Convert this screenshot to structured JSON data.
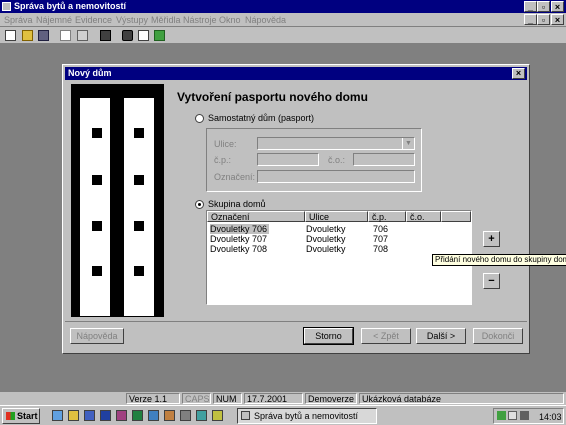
{
  "app": {
    "title": "Správa bytů a nemovitostí",
    "controls": {
      "minimize": "_",
      "restore": "▫",
      "close": "×"
    }
  },
  "menubar": [
    {
      "label": "Správa",
      "enabled": false
    },
    {
      "label": "Nájemné",
      "enabled": false
    },
    {
      "label": "Evidence",
      "enabled": false
    },
    {
      "label": "Výstupy",
      "enabled": false
    },
    {
      "label": "Měřidla",
      "enabled": false
    },
    {
      "label": "Nástroje",
      "enabled": false
    },
    {
      "label": "Okno",
      "enabled": false
    },
    {
      "label": "Nápověda",
      "enabled": false
    }
  ],
  "toolbar": [
    "new-file-icon",
    "open-folder-icon",
    "save-icon",
    "print-preview-icon",
    "print-icon",
    "binoculars-icon",
    "tools-icon",
    "grid-icon",
    "paint-icon"
  ],
  "dialog": {
    "title": "Nový dům",
    "close": "×",
    "heading": "Vytvoření pasportu nového domu",
    "option_single": "Samostatný dům (pasport)",
    "street_label": "Ulice:",
    "cp_label": "č.p.:",
    "co_label": "č.o.:",
    "designation_label": "Označení:",
    "option_group": "Skupina domů",
    "list_headers": [
      "Označení",
      "Ulice",
      "č.p.",
      "č.o."
    ],
    "list_rows": [
      [
        "Dvouletky 706",
        "Dvouletky",
        "706",
        ""
      ],
      [
        "Dvouletky 707",
        "Dvouletky",
        "707",
        ""
      ],
      [
        "Dvouletky 708",
        "Dvouletky",
        "708",
        ""
      ]
    ],
    "add_button": "+",
    "remove_button": "−",
    "tooltip": "Přidání nového domu do skupiny domů",
    "help_button": "Nápověda",
    "cancel_button": "Storno",
    "back_button": "< Zpět",
    "next_button": "Další >",
    "finish_button": "Dokonči"
  },
  "statusbar": [
    "Verze 1.1",
    "CAPS",
    "NUM",
    "17.7.2001",
    "Demoverze",
    "Ukázková databáze"
  ],
  "taskbar": {
    "start_label": "Start",
    "window_button": "Správa bytů a nemovitostí",
    "clock": "14:03"
  }
}
